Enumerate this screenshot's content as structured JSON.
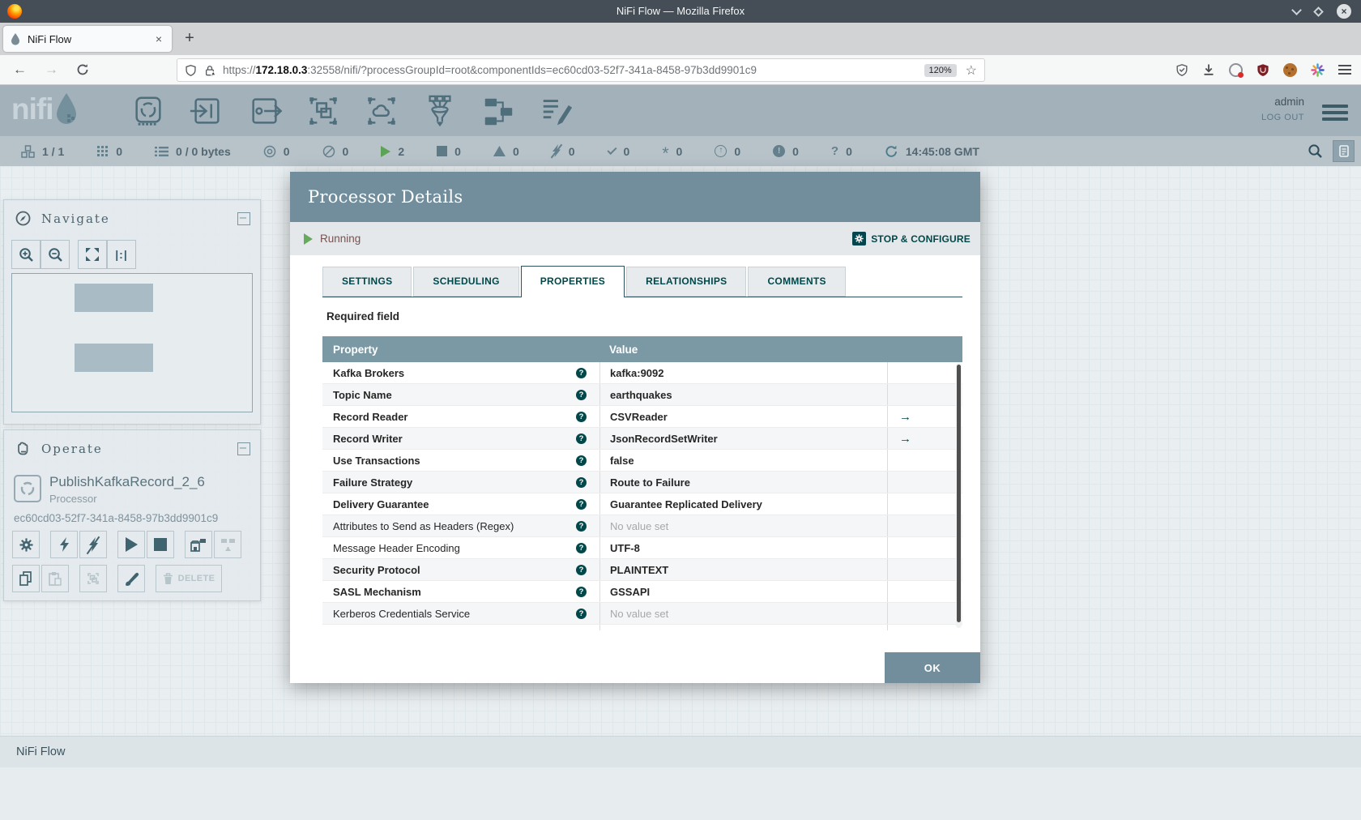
{
  "icons": {
    "back": "←",
    "forward": "→",
    "star": "☆",
    "close": "×",
    "plus": "+",
    "minus": "−",
    "up_arrow": "↑",
    "exclamation": "!",
    "question": "?",
    "asterisk": "*",
    "one_to_one": "|:|",
    "goto_arrow": "→",
    "help": "?"
  },
  "browser": {
    "window_title": "NiFi Flow — Mozilla Firefox",
    "tab_title": "NiFi Flow",
    "url": {
      "scheme": "https://",
      "host": "172.18.0.3",
      "rest": ":32558/nifi/?processGroupId=root&componentIds=ec60cd03-52f7-341a-8458-97b3dd9901c9"
    },
    "zoom_level": "120%"
  },
  "nifi_header": {
    "logo_text": "nifi",
    "username": "admin",
    "logout_label": "LOG OUT"
  },
  "statusbar": {
    "connected_nodes": "1 / 1",
    "active_threads": "0",
    "queued": "0 / 0 bytes",
    "transmitting": "0",
    "not_transmitting": "0",
    "running": "2",
    "stopped": "0",
    "invalid": "0",
    "disabled": "0",
    "up_to_date": "0",
    "locally_modified": "0",
    "stale": "0",
    "locally_modified_stale": "0",
    "sync_failure": "0",
    "last_refresh": "14:45:08 GMT"
  },
  "navigate_panel": {
    "title": "Navigate"
  },
  "operate_panel": {
    "title": "Operate",
    "component_name": "PublishKafkaRecord_2_6",
    "component_type": "Processor",
    "component_id": "ec60cd03-52f7-341a-8458-97b3dd9901c9",
    "delete_label": "DELETE"
  },
  "dialog": {
    "title": "Processor Details",
    "run_status": "Running",
    "stop_configure_label": "STOP & CONFIGURE",
    "tabs": {
      "settings": "SETTINGS",
      "scheduling": "SCHEDULING",
      "properties": "PROPERTIES",
      "relationships": "RELATIONSHIPS",
      "comments": "COMMENTS"
    },
    "active_tab": "PROPERTIES",
    "required_field_note": "Required field",
    "properties_table": {
      "headers": {
        "property": "Property",
        "value": "Value"
      },
      "rows": [
        {
          "name": "Kafka Brokers",
          "required": true,
          "value": "kafka:9092"
        },
        {
          "name": "Topic Name",
          "required": true,
          "value": "earthquakes"
        },
        {
          "name": "Record Reader",
          "required": true,
          "value": "CSVReader",
          "goto": true
        },
        {
          "name": "Record Writer",
          "required": true,
          "value": "JsonRecordSetWriter",
          "goto": true
        },
        {
          "name": "Use Transactions",
          "required": true,
          "value": "false"
        },
        {
          "name": "Failure Strategy",
          "required": true,
          "value": "Route to Failure"
        },
        {
          "name": "Delivery Guarantee",
          "required": true,
          "value": "Guarantee Replicated Delivery"
        },
        {
          "name": "Attributes to Send as Headers (Regex)",
          "required": false,
          "value": "No value set",
          "empty": true
        },
        {
          "name": "Message Header Encoding",
          "required": false,
          "value": "UTF-8"
        },
        {
          "name": "Security Protocol",
          "required": true,
          "value": "PLAINTEXT"
        },
        {
          "name": "SASL Mechanism",
          "required": true,
          "value": "GSSAPI"
        },
        {
          "name": "Kerberos Credentials Service",
          "required": false,
          "value": "No value set",
          "empty": true
        }
      ]
    },
    "ok_label": "OK"
  },
  "breadcrumb": {
    "root": "NiFi Flow"
  },
  "colors": {
    "accent_teal": "#004849",
    "dialog_header": "#728e9c",
    "running_green": "#67aa5b",
    "status_text": "#775351"
  }
}
